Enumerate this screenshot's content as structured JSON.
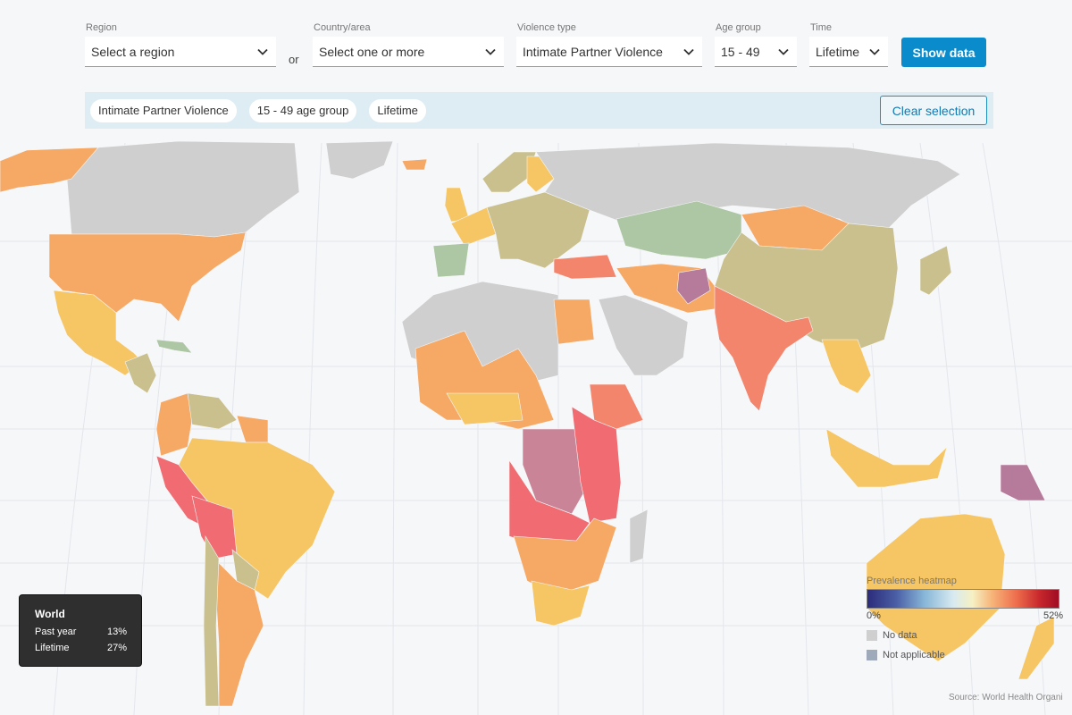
{
  "filters": {
    "region": {
      "label": "Region",
      "value": "Select a region"
    },
    "or_label": "or",
    "country": {
      "label": "Country/area",
      "value": "Select one or more"
    },
    "violence_type": {
      "label": "Violence type",
      "value": "Intimate Partner Violence"
    },
    "age_group": {
      "label": "Age group",
      "value": "15 - 49"
    },
    "time": {
      "label": "Time",
      "value": "Lifetime"
    },
    "show_button": "Show data"
  },
  "selection": {
    "chips": [
      "Intimate Partner Violence",
      "15 - 49 age group",
      "Lifetime"
    ],
    "clear_button": "Clear selection"
  },
  "world_summary": {
    "title": "World",
    "rows": [
      {
        "label": "Past year",
        "value": "13%"
      },
      {
        "label": "Lifetime",
        "value": "27%"
      }
    ]
  },
  "legend": {
    "title": "Prevalence heatmap",
    "min": "0%",
    "max": "52%",
    "no_data": "No data",
    "not_applicable": "Not applicable",
    "colors": {
      "no_data": "#cfcfcf",
      "not_applicable": "#9eaab9"
    }
  },
  "source": "Source: World Health Organi",
  "palette": {
    "nodata": "#cfcfcf",
    "na": "#98a8bb",
    "olive": "#c9c08e",
    "green": "#adc6a3",
    "yellow": "#f6c564",
    "orange": "#f6a865",
    "salmon": "#f3856c",
    "red": "#f06c72",
    "mauve": "#c98597",
    "teal": "#7cc2cf",
    "purple": "#b67b9a"
  },
  "regions": [
    {
      "name": "canada",
      "color": "nodata"
    },
    {
      "name": "greenland",
      "color": "nodata"
    },
    {
      "name": "alaska",
      "color": "orange"
    },
    {
      "name": "usa",
      "color": "orange"
    },
    {
      "name": "mexico",
      "color": "yellow"
    },
    {
      "name": "central-america",
      "color": "olive"
    },
    {
      "name": "cuba",
      "color": "green"
    },
    {
      "name": "colombia",
      "color": "orange"
    },
    {
      "name": "venezuela",
      "color": "olive"
    },
    {
      "name": "guyana",
      "color": "orange"
    },
    {
      "name": "brazil",
      "color": "yellow"
    },
    {
      "name": "peru",
      "color": "red"
    },
    {
      "name": "bolivia",
      "color": "red"
    },
    {
      "name": "paraguay",
      "color": "olive"
    },
    {
      "name": "argentina",
      "color": "orange"
    },
    {
      "name": "chile",
      "color": "olive"
    },
    {
      "name": "iceland",
      "color": "orange"
    },
    {
      "name": "uk",
      "color": "yellow"
    },
    {
      "name": "scandinavia",
      "color": "olive"
    },
    {
      "name": "finland",
      "color": "yellow"
    },
    {
      "name": "france",
      "color": "yellow"
    },
    {
      "name": "iberia",
      "color": "green"
    },
    {
      "name": "central-europe",
      "color": "olive"
    },
    {
      "name": "turkey",
      "color": "salmon"
    },
    {
      "name": "russia",
      "color": "nodata"
    },
    {
      "name": "kazakhstan",
      "color": "green"
    },
    {
      "name": "mongolia",
      "color": "orange"
    },
    {
      "name": "china",
      "color": "olive"
    },
    {
      "name": "iran",
      "color": "orange"
    },
    {
      "name": "afghanistan",
      "color": "purple"
    },
    {
      "name": "india",
      "color": "salmon"
    },
    {
      "name": "arabia",
      "color": "nodata"
    },
    {
      "name": "north-africa",
      "color": "nodata"
    },
    {
      "name": "egypt",
      "color": "orange"
    },
    {
      "name": "west-africa",
      "color": "orange"
    },
    {
      "name": "sahel",
      "color": "yellow"
    },
    {
      "name": "ethiopia",
      "color": "salmon"
    },
    {
      "name": "drc",
      "color": "mauve"
    },
    {
      "name": "east-africa",
      "color": "red"
    },
    {
      "name": "angola-zambia",
      "color": "red"
    },
    {
      "name": "southern-africa",
      "color": "orange"
    },
    {
      "name": "south-africa",
      "color": "yellow"
    },
    {
      "name": "madagascar",
      "color": "nodata"
    },
    {
      "name": "southeast-asia",
      "color": "yellow"
    },
    {
      "name": "japan",
      "color": "olive"
    },
    {
      "name": "indonesia",
      "color": "yellow"
    },
    {
      "name": "papua",
      "color": "purple"
    },
    {
      "name": "australia",
      "color": "yellow"
    },
    {
      "name": "new-zealand",
      "color": "yellow"
    }
  ]
}
